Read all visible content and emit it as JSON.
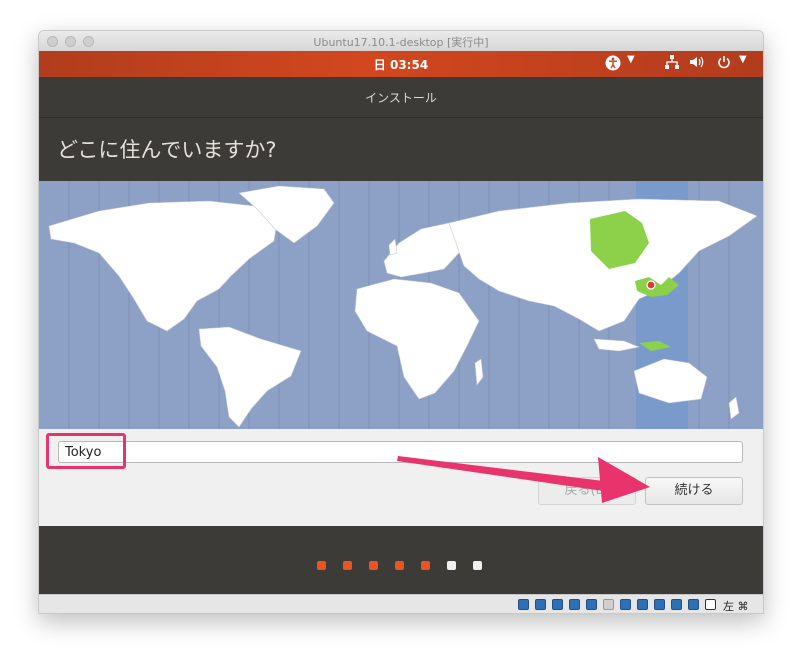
{
  "window": {
    "title": "Ubuntu17.10.1-desktop [実行中]"
  },
  "topbar": {
    "clock": "日 03:54",
    "accessibility_icon": "accessibility-icon",
    "network_icon": "network-icon",
    "volume_icon": "volume-icon",
    "power_icon": "power-icon"
  },
  "installer": {
    "window_title": "インストール",
    "heading": "どこに住んでいますか?",
    "location_value": "Tokyo",
    "back_label": "戻る(B)",
    "continue_label": "続ける"
  },
  "progress": {
    "total_steps": 7,
    "completed_steps": 5,
    "accent": "#e95420",
    "pending": "#f0f0f0"
  },
  "statusbar": {
    "host_key": "左 ⌘"
  },
  "colors": {
    "accent_highlight": "#e8336d",
    "ocean": "#8da0c5",
    "selected_zone": "#7a9acb",
    "selected_country": "#8dd14a"
  }
}
